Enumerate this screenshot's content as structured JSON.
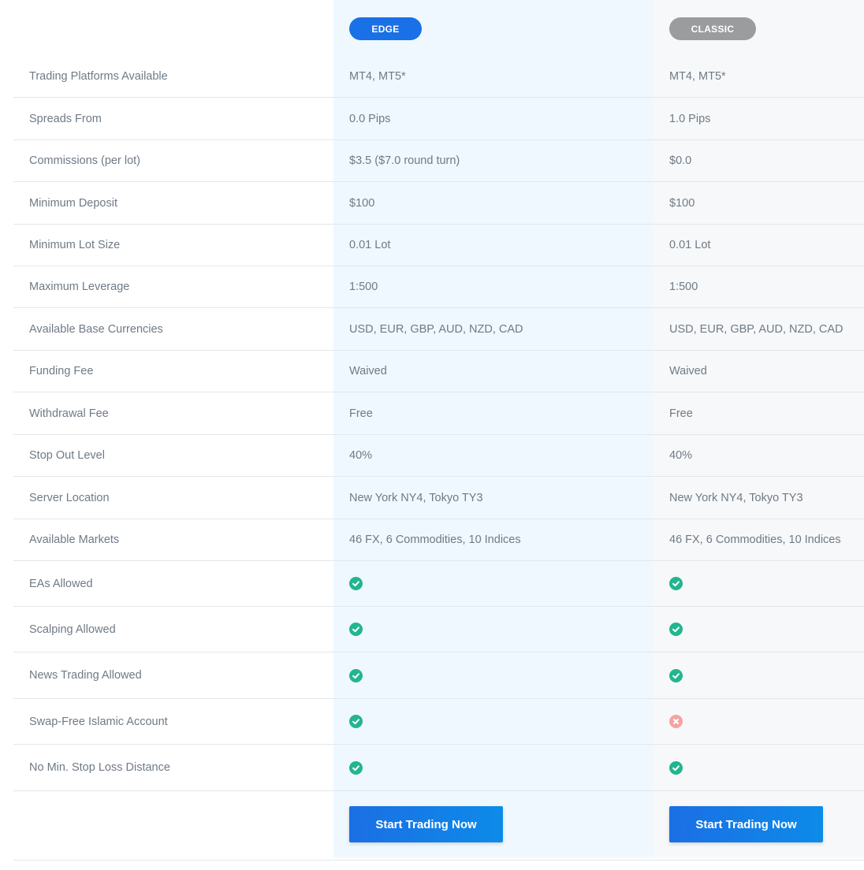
{
  "colors": {
    "edge_pill": "#1a70e6",
    "classic_pill": "#9a9c9e",
    "check": "#23b58f",
    "cross": "#f4a3a3",
    "button": "#1b78e7"
  },
  "plans": {
    "edge": {
      "label": "EDGE"
    },
    "classic": {
      "label": "CLASSIC"
    }
  },
  "rows": [
    {
      "label": "Trading Platforms Available",
      "edge": "MT4, MT5*",
      "classic": "MT4, MT5*"
    },
    {
      "label": "Spreads From",
      "edge": "0.0 Pips",
      "classic": "1.0 Pips"
    },
    {
      "label": "Commissions (per lot)",
      "edge": "$3.5 ($7.0 round turn)",
      "classic": "$0.0"
    },
    {
      "label": "Minimum Deposit",
      "edge": "$100",
      "classic": "$100"
    },
    {
      "label": "Minimum Lot Size",
      "edge": "0.01 Lot",
      "classic": "0.01 Lot"
    },
    {
      "label": "Maximum Leverage",
      "edge": "1:500",
      "classic": "1:500"
    },
    {
      "label": "Available Base Currencies",
      "edge": "USD, EUR, GBP, AUD, NZD, CAD",
      "classic": "USD, EUR, GBP, AUD, NZD, CAD"
    },
    {
      "label": "Funding Fee",
      "edge": "Waived",
      "classic": "Waived"
    },
    {
      "label": "Withdrawal Fee",
      "edge": "Free",
      "classic": "Free"
    },
    {
      "label": "Stop Out Level",
      "edge": "40%",
      "classic": "40%"
    },
    {
      "label": "Server Location",
      "edge": "New York NY4, Tokyo TY3",
      "classic": "New York NY4, Tokyo TY3"
    },
    {
      "label": "Available Markets",
      "edge": "46 FX, 6 Commodities, 10 Indices",
      "classic": "46 FX, 6 Commodities, 10 Indices"
    }
  ],
  "feature_rows": [
    {
      "label": "EAs Allowed",
      "edge": "check-icon",
      "classic": "check-icon"
    },
    {
      "label": "Scalping Allowed",
      "edge": "check-icon",
      "classic": "check-icon"
    },
    {
      "label": "News Trading Allowed",
      "edge": "check-icon",
      "classic": "check-icon"
    },
    {
      "label": "Swap-Free Islamic Account",
      "edge": "check-icon",
      "classic": "cross-icon"
    },
    {
      "label": "No Min. Stop Loss Distance",
      "edge": "check-icon",
      "classic": "check-icon"
    }
  ],
  "cta": {
    "edge_label": "Start Trading Now",
    "classic_label": "Start Trading Now"
  }
}
